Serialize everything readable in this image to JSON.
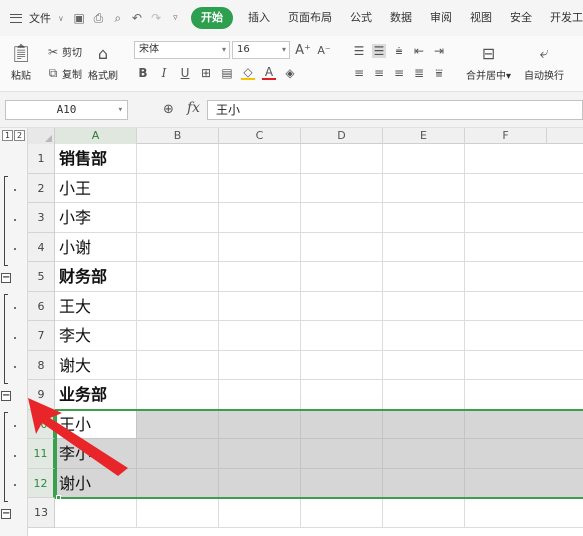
{
  "menubar": {
    "file_label": "文件",
    "tabs": [
      {
        "label": "开始",
        "active": true
      },
      {
        "label": "插入"
      },
      {
        "label": "页面布局"
      },
      {
        "label": "公式"
      },
      {
        "label": "数据"
      },
      {
        "label": "审阅"
      },
      {
        "label": "视图"
      },
      {
        "label": "安全"
      },
      {
        "label": "开发工"
      }
    ]
  },
  "ribbon": {
    "paste": "粘贴",
    "cut": "剪切",
    "copy": "复制",
    "format_painter": "格式刷",
    "font_name": "宋体",
    "font_size": "16",
    "merge_center": "合并居中",
    "wrap_text": "自动换行"
  },
  "formula_bar": {
    "name_box": "A10",
    "fx": "fx",
    "content": "王小"
  },
  "outline": {
    "levels": [
      "1",
      "2"
    ]
  },
  "columns": [
    "A",
    "B",
    "C",
    "D",
    "E",
    "F"
  ],
  "rows": [
    {
      "num": "1",
      "a": "销售部",
      "bold": true
    },
    {
      "num": "2",
      "a": "小王"
    },
    {
      "num": "3",
      "a": "小李"
    },
    {
      "num": "4",
      "a": "小谢"
    },
    {
      "num": "5",
      "a": "财务部",
      "bold": true
    },
    {
      "num": "6",
      "a": "王大"
    },
    {
      "num": "7",
      "a": "李大"
    },
    {
      "num": "8",
      "a": "谢大"
    },
    {
      "num": "9",
      "a": "业务部",
      "bold": true
    },
    {
      "num": "10",
      "a": "王小",
      "selected": true
    },
    {
      "num": "11",
      "a": "李小",
      "selected": true
    },
    {
      "num": "12",
      "a": "谢小",
      "selected": true
    },
    {
      "num": "13",
      "a": ""
    }
  ],
  "colors": {
    "accent": "#2d9f4e",
    "selection_fill": "#d6d6d6",
    "arrow": "#e8262a"
  }
}
